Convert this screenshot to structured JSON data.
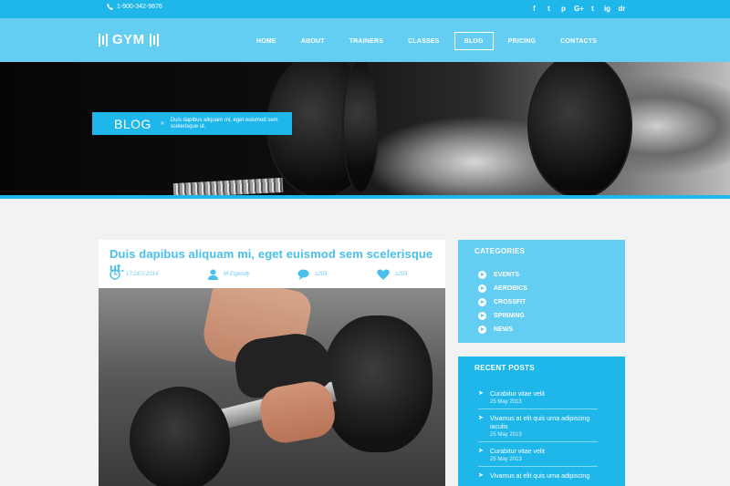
{
  "topbar": {
    "phone": "1-900-342-9876",
    "social": [
      "f",
      "t",
      "p",
      "G+",
      "t",
      "ig",
      "dr"
    ]
  },
  "logo": {
    "text": "GYM"
  },
  "nav": {
    "items": [
      "HOME",
      "ABOUT",
      "TRAINERS",
      "CLASSES",
      "BLOG",
      "PRICING",
      "CONTACTS"
    ],
    "active": "BLOG"
  },
  "banner": {
    "title": "BLOG",
    "separator": "»",
    "breadcrumb": "Duis dapibus aliquam mi, eget euismod sem scelerisque ut."
  },
  "post": {
    "title": "Duis dapibus aliquam mi, eget euismod sem scelerisque ut.",
    "date": "17.DEV.2014",
    "author": "M-Elgendy",
    "comments": "1205",
    "likes": "1205"
  },
  "categories": {
    "heading": "CATEGORIES",
    "items": [
      "EVENTS",
      "AEROBICS",
      "CROSSFIT",
      "SPINNING",
      "NEWS"
    ]
  },
  "recent": {
    "heading": "RECENT POSTS",
    "items": [
      {
        "title": "Curabitur vitae velit",
        "date": "25 May 2013"
      },
      {
        "title": "Vivamus at elit quis urna adipiscing iaculis",
        "date": "25 May 2013"
      },
      {
        "title": "Curabitur vitae velit",
        "date": "25 May 2013"
      },
      {
        "title": "Vivamus at elit quis urna adipiscing",
        "date": ""
      }
    ]
  },
  "colors": {
    "accent": "#1fb6ea",
    "light_accent": "#64cef2",
    "title_blue": "#4ac0ea",
    "background": "#f2f2f2"
  }
}
